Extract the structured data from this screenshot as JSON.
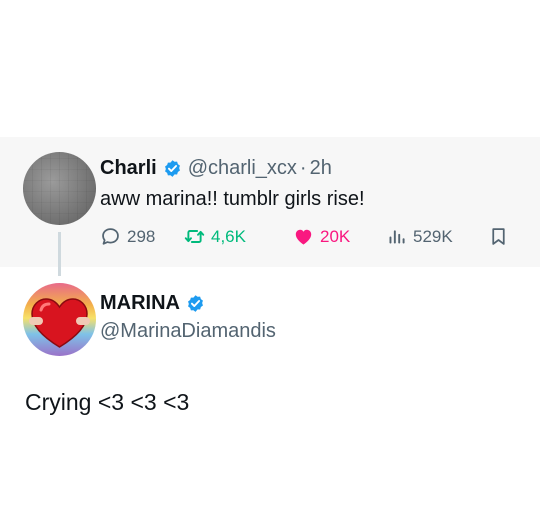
{
  "reply": {
    "author_name": "Charli",
    "author_handle": "@charli_xcx",
    "separator": "·",
    "time": "2h",
    "text": "aww marina!! tumblr girls rise!",
    "stats": {
      "replies": "298",
      "reposts": "4,6K",
      "likes": "20K",
      "views": "529K"
    },
    "verified_icon": "verified-badge-icon",
    "liked": true
  },
  "post": {
    "author_name": "MARINA",
    "author_handle": "@MarinaDiamandis",
    "text": "Crying <3 <3 <3",
    "verified_icon": "verified-badge-icon"
  },
  "colors": {
    "verified": "#1d9bf0",
    "repost": "#00ba7c",
    "like": "#f91880",
    "muted": "#536471",
    "reply_background": "#f7f7f7",
    "thread_line": "#cfd9de"
  },
  "icons": [
    "reply-icon",
    "repost-icon",
    "heart-icon",
    "views-icon",
    "bookmark-icon"
  ]
}
